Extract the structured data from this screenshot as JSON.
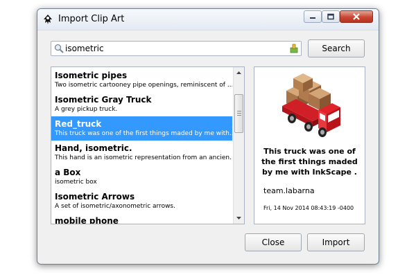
{
  "window": {
    "title": "Import Clip Art",
    "minimize": "minimize",
    "maximize": "maximize",
    "close": "close"
  },
  "search": {
    "value": "isometric",
    "button_label": "Search"
  },
  "results": [
    {
      "title": "Isometric pipes",
      "description": "Two isometric cartooney pipe openings, reminiscent of ...",
      "selected": false
    },
    {
      "title": "Isometric Gray Truck",
      "description": "A grey pickup truck.",
      "selected": false
    },
    {
      "title": "Red_truck",
      "description": "This truck was one of the first things maded by me with...",
      "selected": true
    },
    {
      "title": "Hand, isometric.",
      "description": "This hand is an isometric representation from an ancien...",
      "selected": false
    },
    {
      "title": "a Box",
      "description": "isometric box",
      "selected": false
    },
    {
      "title": "Isometric Arrows",
      "description": "A set of isometric/axonometric arrows.",
      "selected": false
    },
    {
      "title": "mobile phone",
      "description": "",
      "selected": false
    }
  ],
  "preview": {
    "description": "This truck was one of the first things maded by me with InkScape .",
    "author": "team.labarna",
    "date": "Fri, 14 Nov 2014 08:43:19 -0400"
  },
  "buttons": {
    "close_label": "Close",
    "import_label": "Import"
  },
  "colors": {
    "selection": "#3399ff",
    "truck_red": "#e0232b",
    "box_brown": "#b8845a"
  },
  "icons": {
    "app": "inkscape-icon",
    "search": "magnifier-icon",
    "clear": "clear-text-icon"
  }
}
